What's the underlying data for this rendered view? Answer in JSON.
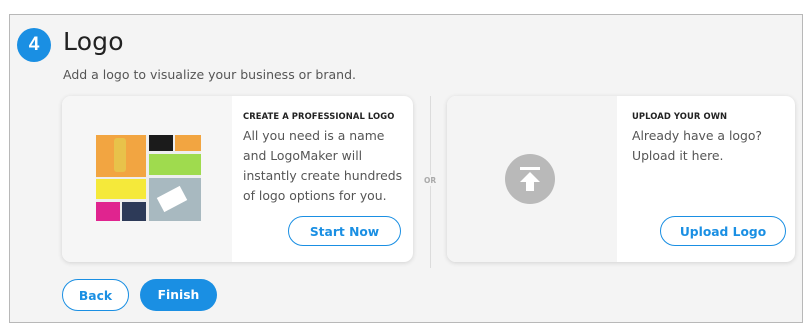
{
  "step": {
    "number": "4",
    "title": "Logo",
    "subtitle": "Add a logo to visualize your business or brand."
  },
  "create_card": {
    "heading": "CREATE A PROFESSIONAL LOGO",
    "body": "All you need is a name and LogoMaker will instantly create hundreds of logo options for you.",
    "button_label": "Start Now",
    "image_icon": "logo-collage-image"
  },
  "separator": {
    "label": "OR"
  },
  "upload_card": {
    "heading": "UPLOAD YOUR OWN",
    "body": "Already have a logo? Upload it here.",
    "button_label": "Upload Logo",
    "icon": "upload-icon"
  },
  "footer": {
    "back_label": "Back",
    "finish_label": "Finish"
  },
  "colors": {
    "accent": "#1a8fe3",
    "panel_bg": "#f4f4f4",
    "card_bg": "#ffffff",
    "upload_icon_bg": "#b9b9b9"
  }
}
